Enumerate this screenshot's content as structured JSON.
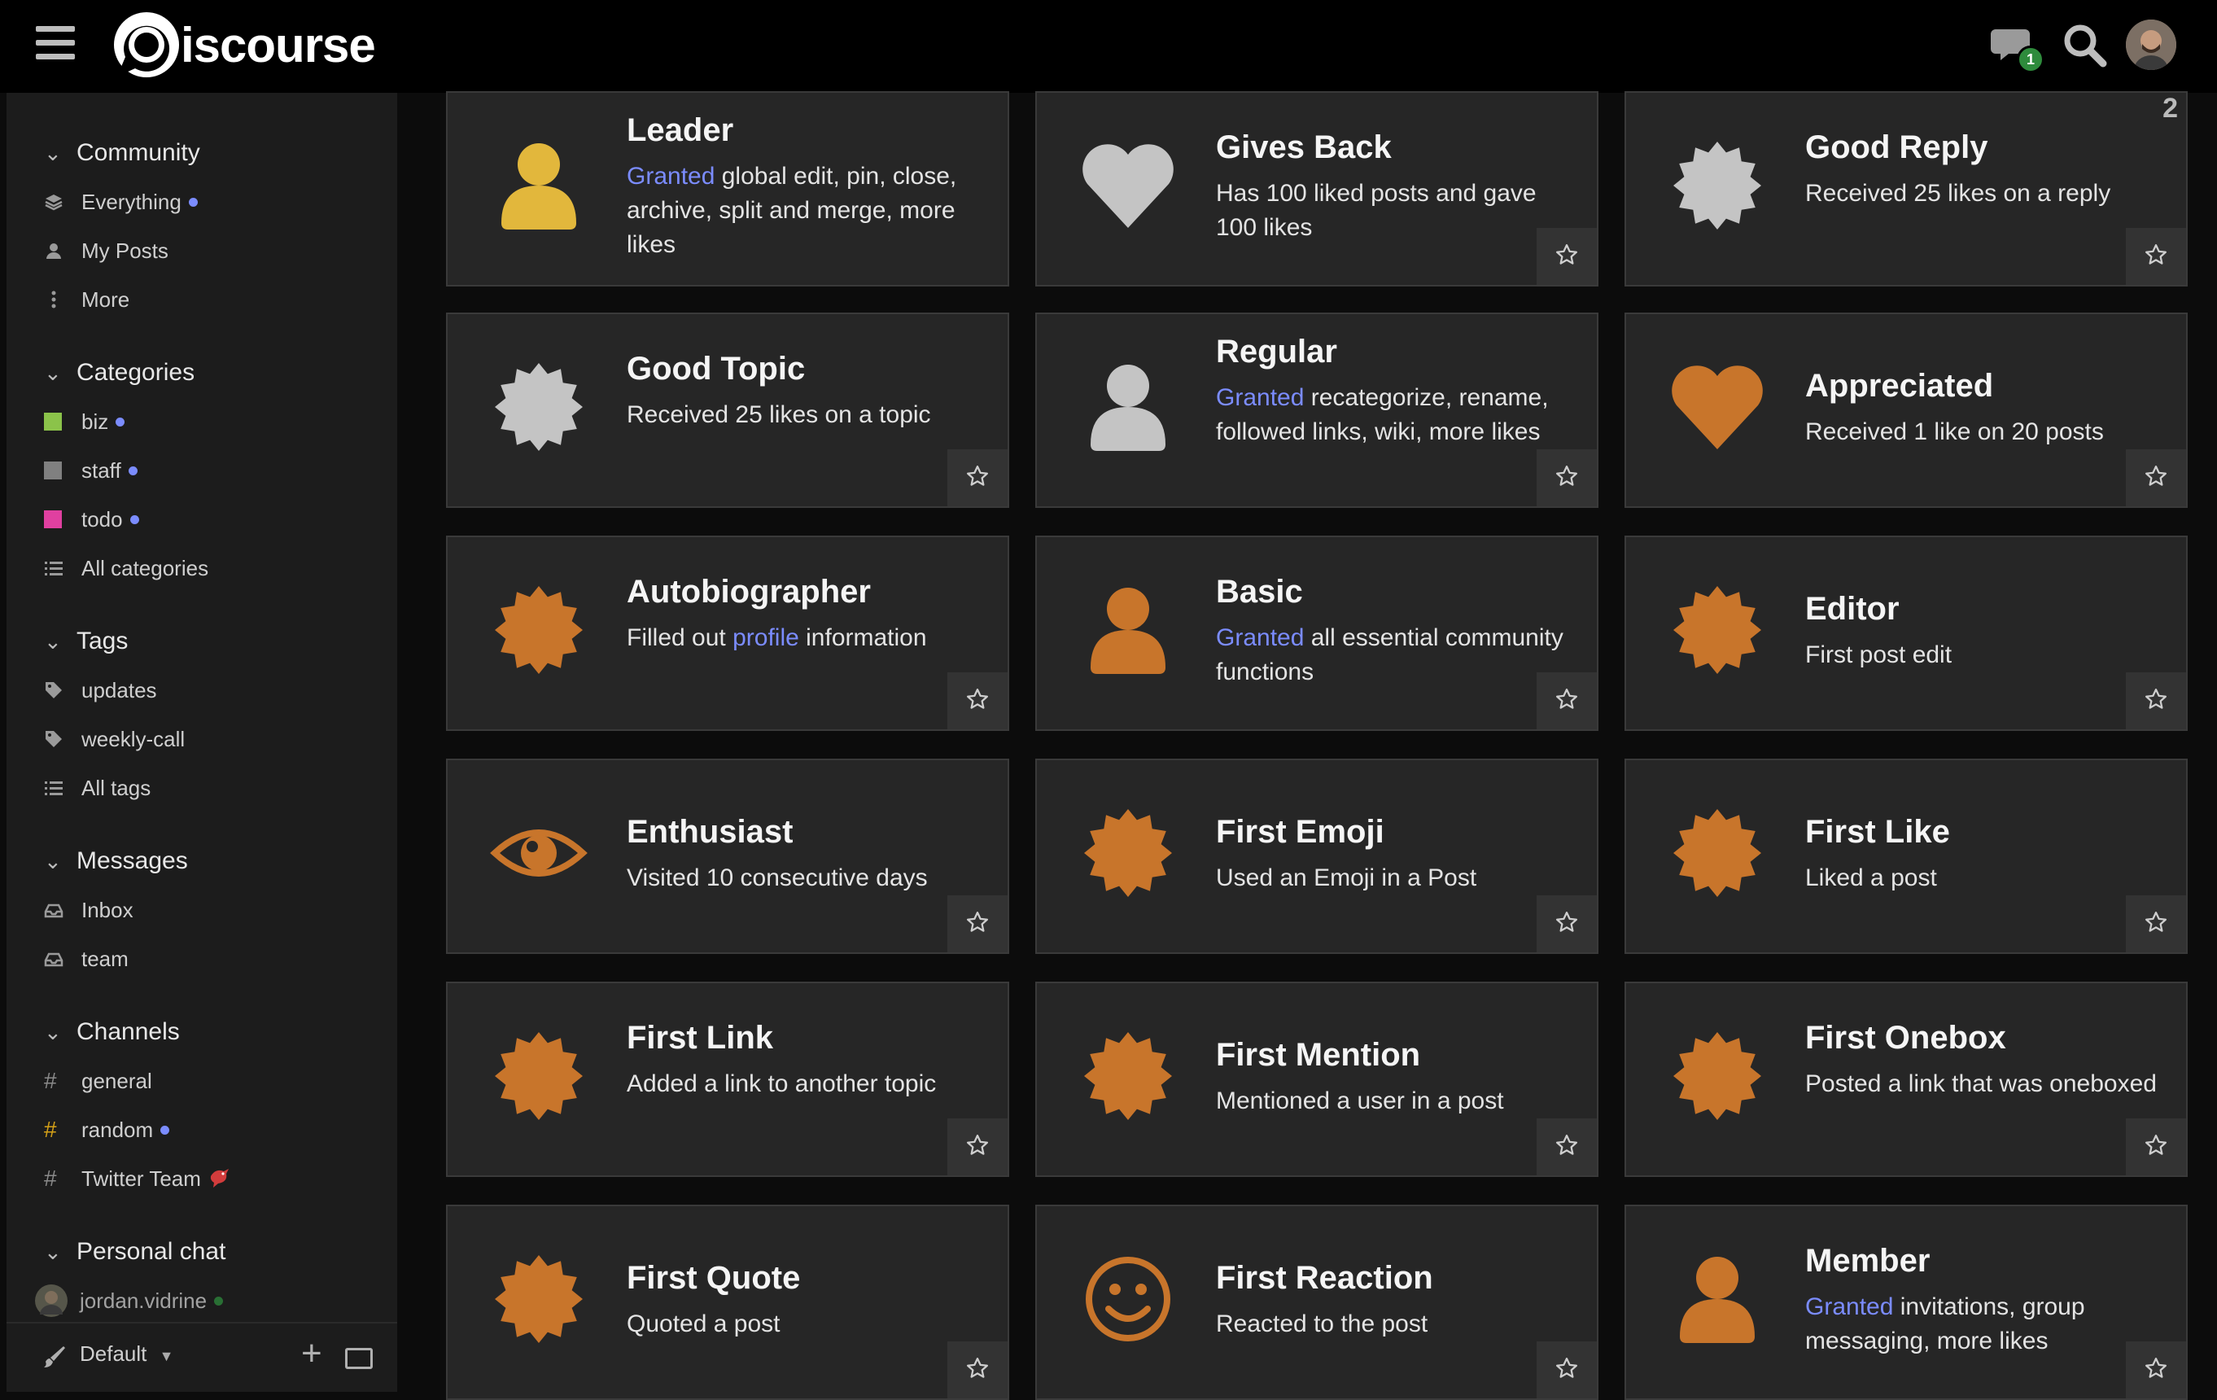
{
  "header": {
    "logo_text": "iscourse",
    "chat_badge": "1",
    "icons": [
      "hamburger-icon",
      "chat-icon",
      "search-icon",
      "avatar"
    ]
  },
  "sidebar": {
    "community": {
      "title": "Community",
      "items": [
        {
          "label": "Everything",
          "icon": "layers-icon",
          "unread": true
        },
        {
          "label": "My Posts",
          "icon": "user-icon",
          "unread": false
        },
        {
          "label": "More",
          "icon": "more-vertical-icon",
          "unread": false
        }
      ]
    },
    "categories": {
      "title": "Categories",
      "items": [
        {
          "label": "biz",
          "color": "#8bc34a",
          "unread": true
        },
        {
          "label": "staff",
          "color": "#808080",
          "unread": true
        },
        {
          "label": "todo",
          "color": "#e040a0",
          "unread": true
        },
        {
          "label": "All categories",
          "icon": "list-icon",
          "unread": false
        }
      ]
    },
    "tags": {
      "title": "Tags",
      "items": [
        {
          "label": "updates",
          "icon": "tag-icon"
        },
        {
          "label": "weekly-call",
          "icon": "tag-icon"
        },
        {
          "label": "All tags",
          "icon": "list-icon"
        }
      ]
    },
    "messages": {
      "title": "Messages",
      "items": [
        {
          "label": "Inbox",
          "icon": "inbox-icon"
        },
        {
          "label": "team",
          "icon": "inbox-icon"
        }
      ]
    },
    "channels": {
      "title": "Channels",
      "items": [
        {
          "label": "general",
          "icon": "hash-icon",
          "unread": false
        },
        {
          "label": "random",
          "icon": "hash-icon",
          "unread": true,
          "hash_color": "#d4a017"
        },
        {
          "label": "Twitter Team",
          "icon": "hash-icon",
          "unread": false,
          "emoji": "bird-emoji"
        }
      ]
    },
    "personal_chat": {
      "title": "Personal chat",
      "items": [
        {
          "label": "jordan.vidrine",
          "icon": "avatar",
          "online": true
        }
      ]
    },
    "bottom": {
      "default_label": "Default"
    }
  },
  "colors": {
    "gold": "#e2b73c",
    "bronze": "#c8752b",
    "silver": "#c4c4c4",
    "link": "#7b8cff"
  },
  "badges": [
    {
      "title": "Leader",
      "desc_link": "Granted",
      "desc": " global edit, pin, close, archive, split and merge, more likes",
      "icon": "person-icon",
      "tier": "gold",
      "count": ""
    },
    {
      "title": "Gives Back",
      "desc_link": "",
      "desc": "Has 100 liked posts and gave 100 likes",
      "icon": "heart-icon",
      "tier": "silver",
      "count": ""
    },
    {
      "title": "Good Reply",
      "desc_link": "",
      "desc": "Received 25 likes on a reply",
      "icon": "certificate-icon",
      "tier": "silver",
      "count": "2"
    },
    {
      "title": "Good Topic",
      "desc_link": "",
      "desc": "Received 25 likes on a topic",
      "icon": "certificate-icon",
      "tier": "silver",
      "count": ""
    },
    {
      "title": "Regular",
      "desc_link": "Granted",
      "desc": " recategorize, rename, followed links, wiki, more likes",
      "icon": "person-icon",
      "tier": "silver",
      "count": ""
    },
    {
      "title": "Appreciated",
      "desc_link": "",
      "desc": "Received 1 like on 20 posts",
      "icon": "heart-icon",
      "tier": "bronze",
      "count": ""
    },
    {
      "title": "Autobiographer",
      "desc_link": "",
      "desc_pre": "Filled out ",
      "desc_mid_link": "profile",
      "desc": " information",
      "icon": "certificate-icon",
      "tier": "bronze",
      "count": ""
    },
    {
      "title": "Basic",
      "desc_link": "Granted",
      "desc": " all essential community functions",
      "icon": "person-icon",
      "tier": "bronze",
      "count": ""
    },
    {
      "title": "Editor",
      "desc_link": "",
      "desc": "First post edit",
      "icon": "certificate-icon",
      "tier": "bronze",
      "count": ""
    },
    {
      "title": "Enthusiast",
      "desc_link": "",
      "desc": "Visited 10 consecutive days",
      "icon": "eye-icon",
      "tier": "bronze",
      "count": ""
    },
    {
      "title": "First Emoji",
      "desc_link": "",
      "desc": "Used an Emoji in a Post",
      "icon": "certificate-icon",
      "tier": "bronze",
      "count": ""
    },
    {
      "title": "First Like",
      "desc_link": "",
      "desc": "Liked a post",
      "icon": "certificate-icon",
      "tier": "bronze",
      "count": ""
    },
    {
      "title": "First Link",
      "desc_link": "",
      "desc": "Added a link to another topic",
      "icon": "certificate-icon",
      "tier": "bronze",
      "count": ""
    },
    {
      "title": "First Mention",
      "desc_link": "",
      "desc": "Mentioned a user in a post",
      "icon": "certificate-icon",
      "tier": "bronze",
      "count": ""
    },
    {
      "title": "First Onebox",
      "desc_link": "",
      "desc": "Posted a link that was oneboxed",
      "icon": "certificate-icon",
      "tier": "bronze",
      "count": ""
    },
    {
      "title": "First Quote",
      "desc_link": "",
      "desc": "Quoted a post",
      "icon": "certificate-icon",
      "tier": "bronze",
      "count": ""
    },
    {
      "title": "First Reaction",
      "desc_link": "",
      "desc": "Reacted to the post",
      "icon": "smile-icon",
      "tier": "bronze",
      "count": ""
    },
    {
      "title": "Member",
      "desc_link": "Granted",
      "desc": " invitations, group messaging, more likes",
      "icon": "person-icon",
      "tier": "bronze",
      "count": ""
    }
  ]
}
